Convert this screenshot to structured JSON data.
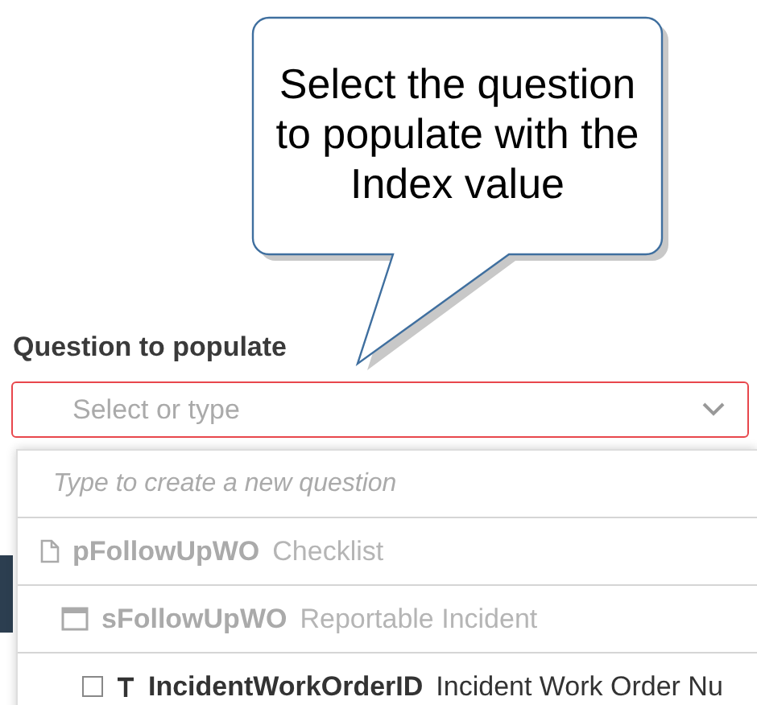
{
  "callout": {
    "text": "Select the question to populate with the Index value"
  },
  "field": {
    "label": "Question to populate",
    "placeholder": "Select or type",
    "invalid": true
  },
  "dropdown": {
    "create_hint": "Type to create a new question",
    "items": [
      {
        "kind": "page",
        "name": "pFollowUpWO",
        "type": "Checklist",
        "disabled": true,
        "children": [
          {
            "kind": "section",
            "name": "sFollowUpWO",
            "type": "Reportable Incident",
            "disabled": true,
            "children": [
              {
                "kind": "text",
                "name": "IncidentWorkOrderID",
                "type": "Incident Work Order Nu",
                "disabled": false,
                "checked": false
              }
            ]
          }
        ]
      }
    ]
  }
}
